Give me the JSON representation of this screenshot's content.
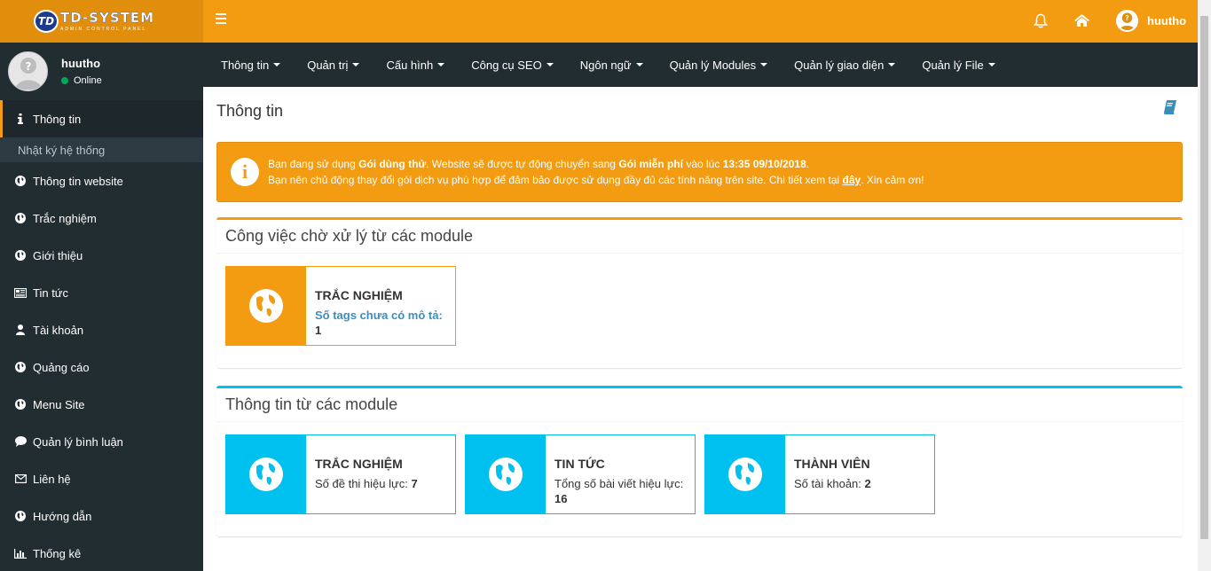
{
  "brand": {
    "mark": "TD",
    "title": "TD-SYSTEM",
    "subtitle": "ADMIN CONTROL PANEL"
  },
  "user": {
    "name": "huutho",
    "status": "Online"
  },
  "sidebar": {
    "items": [
      {
        "label": "Thông tin",
        "icon": "info-icon",
        "active": true
      },
      {
        "label": "Nhật ký hệ thống",
        "icon": "",
        "sub": true
      },
      {
        "label": "Thông tin website",
        "icon": "globe-icon"
      },
      {
        "label": "Trắc nghiệm",
        "icon": "globe-icon"
      },
      {
        "label": "Giới thiệu",
        "icon": "globe-icon"
      },
      {
        "label": "Tin tức",
        "icon": "newspaper-icon"
      },
      {
        "label": "Tài khoản",
        "icon": "user-icon"
      },
      {
        "label": "Quảng cáo",
        "icon": "globe-icon"
      },
      {
        "label": "Menu Site",
        "icon": "globe-icon"
      },
      {
        "label": "Quản lý bình luận",
        "icon": "comment-icon"
      },
      {
        "label": "Liên hệ",
        "icon": "envelope-icon"
      },
      {
        "label": "Hướng dẫn",
        "icon": "globe-icon"
      },
      {
        "label": "Thống kê",
        "icon": "bar-chart-icon"
      }
    ]
  },
  "header": {
    "user_name": "huutho"
  },
  "nav": {
    "items": [
      "Thông tin",
      "Quản trị",
      "Cấu hình",
      "Công cụ SEO",
      "Ngôn ngữ",
      "Quản lý Modules",
      "Quản lý giao diện",
      "Quản lý File"
    ]
  },
  "page": {
    "title": "Thông tin"
  },
  "alert": {
    "line1_a": "Bạn đang sử dụng ",
    "line1_b": "Gói dùng thử",
    "line1_c": ". Website sẽ được tự động chuyển sang ",
    "line1_d": "Gói miễn phí",
    "line1_e": " vào lúc ",
    "line1_f": "13:35 09/10/2018",
    "line1_g": ".",
    "line2_a": "Bạn nên chủ động thay đổi gói dịch vụ phù hợp để đảm bảo được sử dụng đầy đủ các tính năng trên site. Chi tiết xem tại ",
    "line2_link": "đây",
    "line2_b": ". Xin cảm ơn!"
  },
  "pending": {
    "title": "Công việc chờ xử lý từ các module",
    "boxes": [
      {
        "title": "TRẮC NGHIỆM",
        "text": "Số tags chưa có mô tả:",
        "value": "1"
      }
    ]
  },
  "modules": {
    "title": "Thông tin từ các module",
    "boxes": [
      {
        "title": "TRẮC NGHIỆM",
        "text": "Số đề thi hiệu lực: ",
        "value": "7"
      },
      {
        "title": "TIN TỨC",
        "text": "Tổng số bài viết hiệu lực: ",
        "value": "16"
      },
      {
        "title": "THÀNH VIÊN",
        "text": "Số tài khoản: ",
        "value": "2"
      }
    ]
  },
  "colors": {
    "accent": "#f39c12",
    "sidebar": "#222d32",
    "info": "#00c0ef"
  }
}
